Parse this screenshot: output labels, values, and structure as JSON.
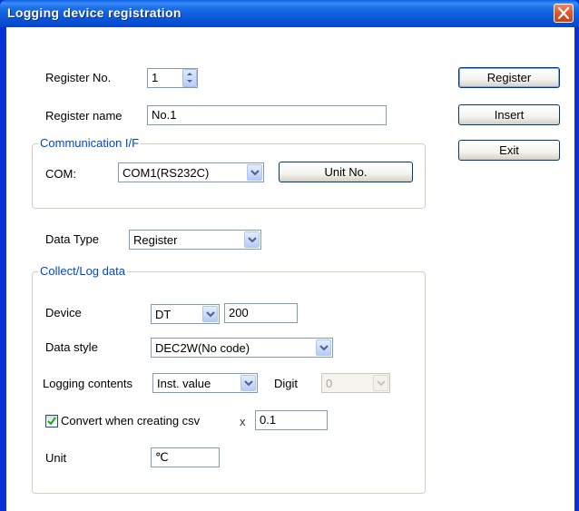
{
  "window": {
    "title": "Logging device registration"
  },
  "register_no": {
    "label": "Register No.",
    "value": "1"
  },
  "register_name": {
    "label": "Register name",
    "value": "No.1"
  },
  "comm": {
    "group_title": "Communication I/F",
    "com_label": "COM:",
    "com_value": "COM1(RS232C)",
    "unit_button": "Unit No."
  },
  "data_type": {
    "label": "Data Type",
    "value": "Register"
  },
  "collect": {
    "group_title": "Collect/Log data",
    "device_label": "Device",
    "device_type": "DT",
    "device_address": "200",
    "data_style_label": "Data style",
    "data_style_value": "DEC2W(No code)",
    "logging_label": "Logging contents",
    "logging_value": "Inst. value",
    "digit_label": "Digit",
    "digit_value": "0",
    "convert_label": "Convert when creating csv",
    "convert_checked": true,
    "multiplier_symbol": "x",
    "factor_value": "0.1",
    "unit_label": "Unit",
    "unit_value": "℃"
  },
  "buttons": {
    "register": "Register",
    "insert": "Insert",
    "exit": "Exit"
  },
  "colors": {
    "title_bar": "#0a55d8",
    "group_title": "#0046d5",
    "close": "#e3572b"
  },
  "icons": {
    "close": "close-icon",
    "spin": "spin-arrows-icon",
    "dropdown": "chevron-down-icon",
    "check": "check-icon"
  }
}
